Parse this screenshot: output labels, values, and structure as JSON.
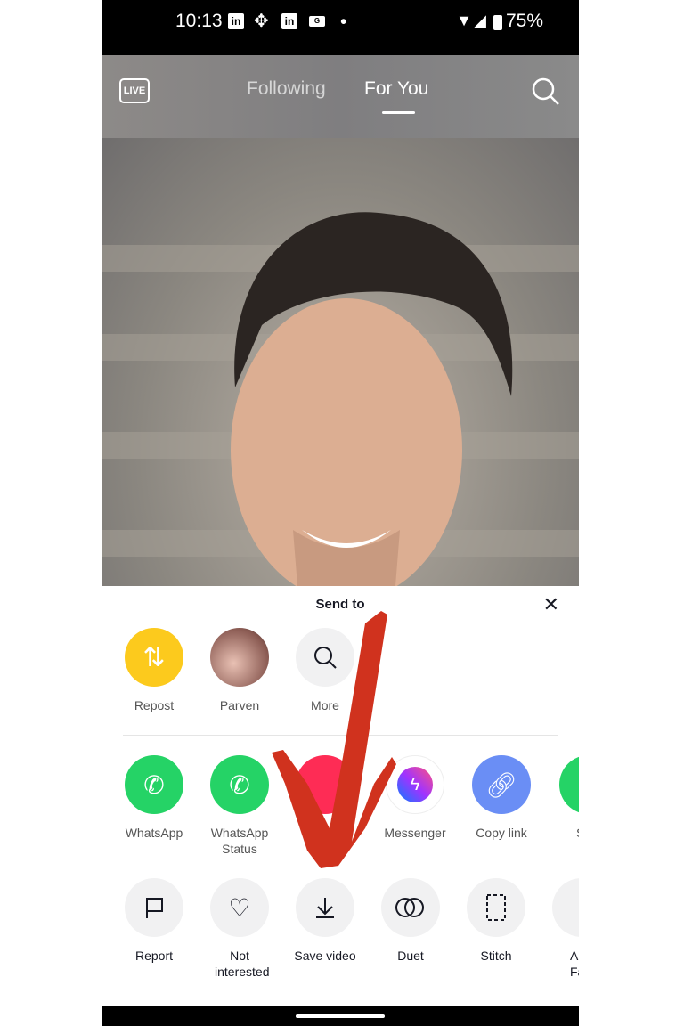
{
  "status": {
    "time": "10:13",
    "battery": "75%"
  },
  "header": {
    "live_label": "LIVE",
    "tabs": [
      {
        "label": "Following",
        "active": false
      },
      {
        "label": "For You",
        "active": true
      }
    ]
  },
  "sheet": {
    "title": "Send to",
    "row1": [
      {
        "label": "Repost",
        "color": "#fcca1d"
      },
      {
        "label": "Parven"
      },
      {
        "label": "More"
      }
    ],
    "row2": [
      {
        "label": "WhatsApp",
        "color": "#25d366"
      },
      {
        "label": "WhatsApp Status",
        "color": "#25d366"
      },
      {
        "label": "",
        "color": "#fe2c55"
      },
      {
        "label": "Messenger"
      },
      {
        "label": "Copy link",
        "color": "#6a8ef5"
      },
      {
        "label": "S",
        "color": "#25d366"
      }
    ],
    "row3": [
      {
        "label": "Report"
      },
      {
        "label": "Not interested"
      },
      {
        "label": "Save video"
      },
      {
        "label": "Duet"
      },
      {
        "label": "Stitch"
      },
      {
        "label": "Add to Favorites"
      }
    ]
  },
  "annotation": {
    "arrow_color": "#d0321e"
  }
}
